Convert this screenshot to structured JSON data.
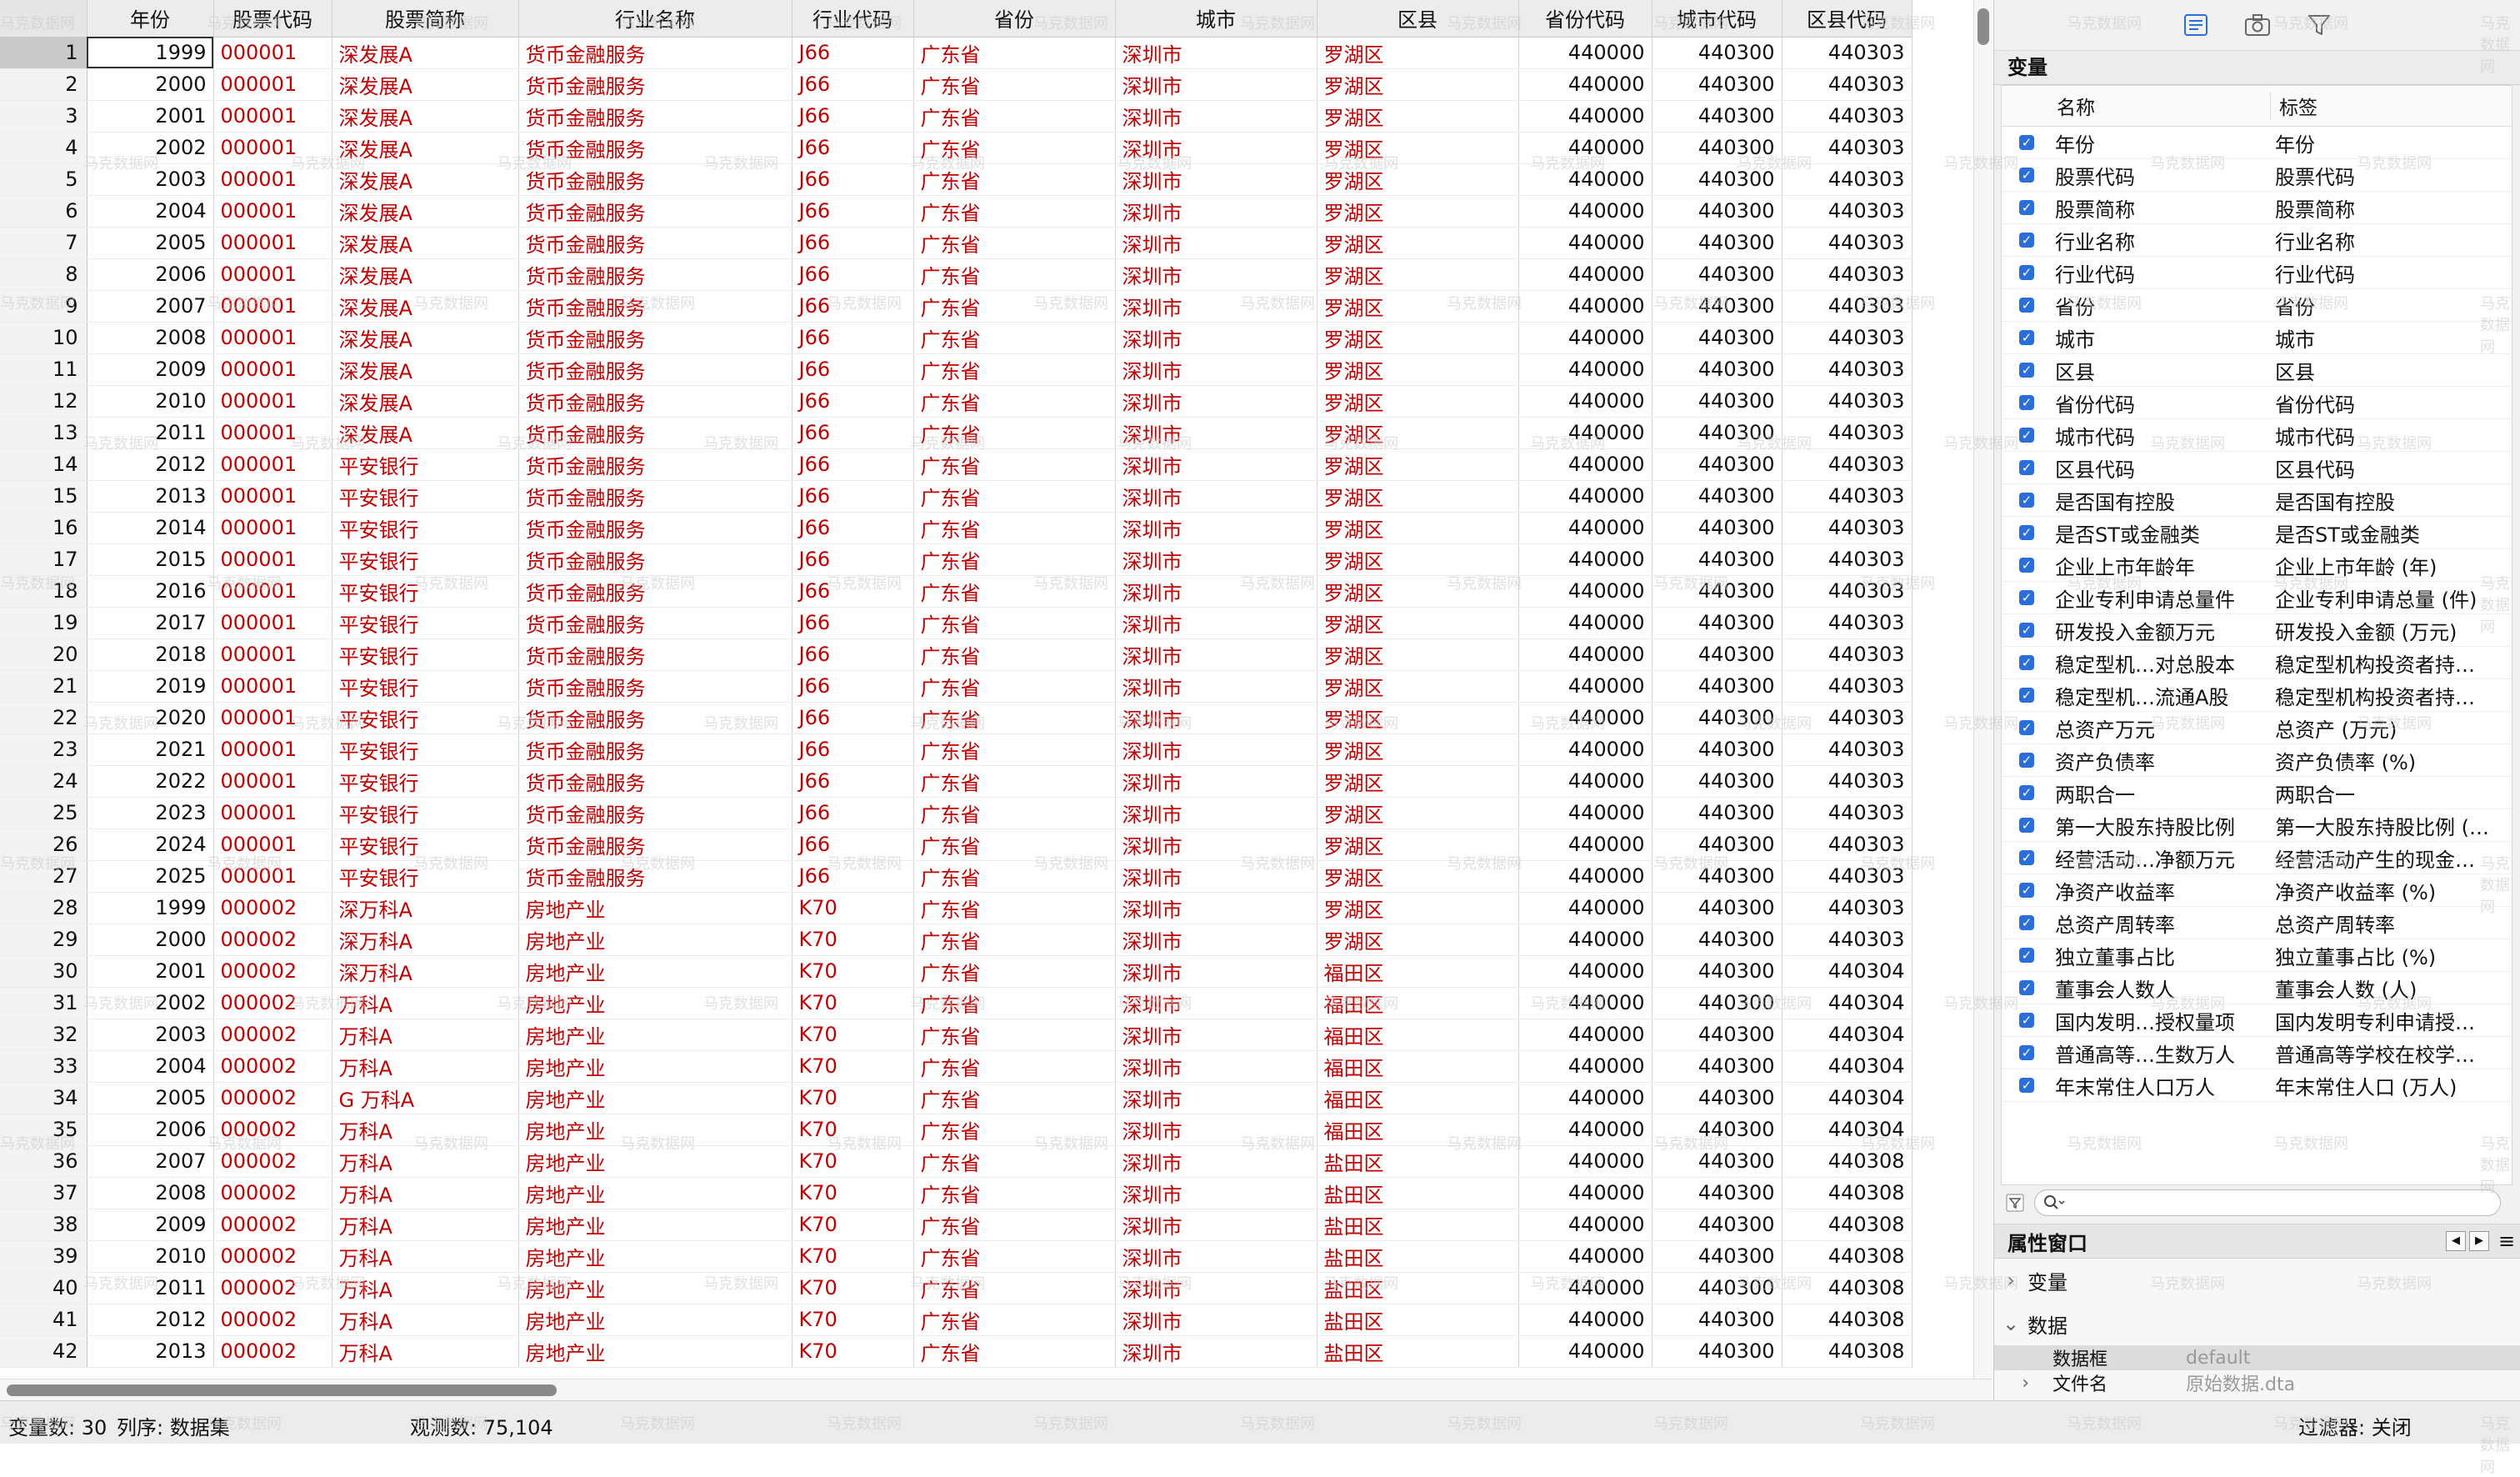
{
  "grid": {
    "columns": [
      {
        "key": "year",
        "label": "年份"
      },
      {
        "key": "code",
        "label": "股票代码"
      },
      {
        "key": "abbr",
        "label": "股票简称"
      },
      {
        "key": "industry",
        "label": "行业名称"
      },
      {
        "key": "ind_code",
        "label": "行业代码"
      },
      {
        "key": "province",
        "label": "省份"
      },
      {
        "key": "city",
        "label": "城市"
      },
      {
        "key": "district",
        "label": "区县"
      },
      {
        "key": "prov_code",
        "label": "省份代码"
      },
      {
        "key": "city_code",
        "label": "城市代码"
      },
      {
        "key": "dist_code",
        "label": "区县代码"
      }
    ],
    "rows": [
      [
        "1",
        "1999",
        "000001",
        "深发展A",
        "货币金融服务",
        "J66",
        "广东省",
        "深圳市",
        "罗湖区",
        "440000",
        "440300",
        "440303"
      ],
      [
        "2",
        "2000",
        "000001",
        "深发展A",
        "货币金融服务",
        "J66",
        "广东省",
        "深圳市",
        "罗湖区",
        "440000",
        "440300",
        "440303"
      ],
      [
        "3",
        "2001",
        "000001",
        "深发展A",
        "货币金融服务",
        "J66",
        "广东省",
        "深圳市",
        "罗湖区",
        "440000",
        "440300",
        "440303"
      ],
      [
        "4",
        "2002",
        "000001",
        "深发展A",
        "货币金融服务",
        "J66",
        "广东省",
        "深圳市",
        "罗湖区",
        "440000",
        "440300",
        "440303"
      ],
      [
        "5",
        "2003",
        "000001",
        "深发展A",
        "货币金融服务",
        "J66",
        "广东省",
        "深圳市",
        "罗湖区",
        "440000",
        "440300",
        "440303"
      ],
      [
        "6",
        "2004",
        "000001",
        "深发展A",
        "货币金融服务",
        "J66",
        "广东省",
        "深圳市",
        "罗湖区",
        "440000",
        "440300",
        "440303"
      ],
      [
        "7",
        "2005",
        "000001",
        "深发展A",
        "货币金融服务",
        "J66",
        "广东省",
        "深圳市",
        "罗湖区",
        "440000",
        "440300",
        "440303"
      ],
      [
        "8",
        "2006",
        "000001",
        "深发展A",
        "货币金融服务",
        "J66",
        "广东省",
        "深圳市",
        "罗湖区",
        "440000",
        "440300",
        "440303"
      ],
      [
        "9",
        "2007",
        "000001",
        "深发展A",
        "货币金融服务",
        "J66",
        "广东省",
        "深圳市",
        "罗湖区",
        "440000",
        "440300",
        "440303"
      ],
      [
        "10",
        "2008",
        "000001",
        "深发展A",
        "货币金融服务",
        "J66",
        "广东省",
        "深圳市",
        "罗湖区",
        "440000",
        "440300",
        "440303"
      ],
      [
        "11",
        "2009",
        "000001",
        "深发展A",
        "货币金融服务",
        "J66",
        "广东省",
        "深圳市",
        "罗湖区",
        "440000",
        "440300",
        "440303"
      ],
      [
        "12",
        "2010",
        "000001",
        "深发展A",
        "货币金融服务",
        "J66",
        "广东省",
        "深圳市",
        "罗湖区",
        "440000",
        "440300",
        "440303"
      ],
      [
        "13",
        "2011",
        "000001",
        "深发展A",
        "货币金融服务",
        "J66",
        "广东省",
        "深圳市",
        "罗湖区",
        "440000",
        "440300",
        "440303"
      ],
      [
        "14",
        "2012",
        "000001",
        "平安银行",
        "货币金融服务",
        "J66",
        "广东省",
        "深圳市",
        "罗湖区",
        "440000",
        "440300",
        "440303"
      ],
      [
        "15",
        "2013",
        "000001",
        "平安银行",
        "货币金融服务",
        "J66",
        "广东省",
        "深圳市",
        "罗湖区",
        "440000",
        "440300",
        "440303"
      ],
      [
        "16",
        "2014",
        "000001",
        "平安银行",
        "货币金融服务",
        "J66",
        "广东省",
        "深圳市",
        "罗湖区",
        "440000",
        "440300",
        "440303"
      ],
      [
        "17",
        "2015",
        "000001",
        "平安银行",
        "货币金融服务",
        "J66",
        "广东省",
        "深圳市",
        "罗湖区",
        "440000",
        "440300",
        "440303"
      ],
      [
        "18",
        "2016",
        "000001",
        "平安银行",
        "货币金融服务",
        "J66",
        "广东省",
        "深圳市",
        "罗湖区",
        "440000",
        "440300",
        "440303"
      ],
      [
        "19",
        "2017",
        "000001",
        "平安银行",
        "货币金融服务",
        "J66",
        "广东省",
        "深圳市",
        "罗湖区",
        "440000",
        "440300",
        "440303"
      ],
      [
        "20",
        "2018",
        "000001",
        "平安银行",
        "货币金融服务",
        "J66",
        "广东省",
        "深圳市",
        "罗湖区",
        "440000",
        "440300",
        "440303"
      ],
      [
        "21",
        "2019",
        "000001",
        "平安银行",
        "货币金融服务",
        "J66",
        "广东省",
        "深圳市",
        "罗湖区",
        "440000",
        "440300",
        "440303"
      ],
      [
        "22",
        "2020",
        "000001",
        "平安银行",
        "货币金融服务",
        "J66",
        "广东省",
        "深圳市",
        "罗湖区",
        "440000",
        "440300",
        "440303"
      ],
      [
        "23",
        "2021",
        "000001",
        "平安银行",
        "货币金融服务",
        "J66",
        "广东省",
        "深圳市",
        "罗湖区",
        "440000",
        "440300",
        "440303"
      ],
      [
        "24",
        "2022",
        "000001",
        "平安银行",
        "货币金融服务",
        "J66",
        "广东省",
        "深圳市",
        "罗湖区",
        "440000",
        "440300",
        "440303"
      ],
      [
        "25",
        "2023",
        "000001",
        "平安银行",
        "货币金融服务",
        "J66",
        "广东省",
        "深圳市",
        "罗湖区",
        "440000",
        "440300",
        "440303"
      ],
      [
        "26",
        "2024",
        "000001",
        "平安银行",
        "货币金融服务",
        "J66",
        "广东省",
        "深圳市",
        "罗湖区",
        "440000",
        "440300",
        "440303"
      ],
      [
        "27",
        "2025",
        "000001",
        "平安银行",
        "货币金融服务",
        "J66",
        "广东省",
        "深圳市",
        "罗湖区",
        "440000",
        "440300",
        "440303"
      ],
      [
        "28",
        "1999",
        "000002",
        "深万科A",
        "房地产业",
        "K70",
        "广东省",
        "深圳市",
        "罗湖区",
        "440000",
        "440300",
        "440303"
      ],
      [
        "29",
        "2000",
        "000002",
        "深万科A",
        "房地产业",
        "K70",
        "广东省",
        "深圳市",
        "罗湖区",
        "440000",
        "440300",
        "440303"
      ],
      [
        "30",
        "2001",
        "000002",
        "深万科A",
        "房地产业",
        "K70",
        "广东省",
        "深圳市",
        "福田区",
        "440000",
        "440300",
        "440304"
      ],
      [
        "31",
        "2002",
        "000002",
        "万科A",
        "房地产业",
        "K70",
        "广东省",
        "深圳市",
        "福田区",
        "440000",
        "440300",
        "440304"
      ],
      [
        "32",
        "2003",
        "000002",
        "万科A",
        "房地产业",
        "K70",
        "广东省",
        "深圳市",
        "福田区",
        "440000",
        "440300",
        "440304"
      ],
      [
        "33",
        "2004",
        "000002",
        "万科A",
        "房地产业",
        "K70",
        "广东省",
        "深圳市",
        "福田区",
        "440000",
        "440300",
        "440304"
      ],
      [
        "34",
        "2005",
        "000002",
        "G 万科A",
        "房地产业",
        "K70",
        "广东省",
        "深圳市",
        "福田区",
        "440000",
        "440300",
        "440304"
      ],
      [
        "35",
        "2006",
        "000002",
        "万科A",
        "房地产业",
        "K70",
        "广东省",
        "深圳市",
        "福田区",
        "440000",
        "440300",
        "440304"
      ],
      [
        "36",
        "2007",
        "000002",
        "万科A",
        "房地产业",
        "K70",
        "广东省",
        "深圳市",
        "盐田区",
        "440000",
        "440300",
        "440308"
      ],
      [
        "37",
        "2008",
        "000002",
        "万科A",
        "房地产业",
        "K70",
        "广东省",
        "深圳市",
        "盐田区",
        "440000",
        "440300",
        "440308"
      ],
      [
        "38",
        "2009",
        "000002",
        "万科A",
        "房地产业",
        "K70",
        "广东省",
        "深圳市",
        "盐田区",
        "440000",
        "440300",
        "440308"
      ],
      [
        "39",
        "2010",
        "000002",
        "万科A",
        "房地产业",
        "K70",
        "广东省",
        "深圳市",
        "盐田区",
        "440000",
        "440300",
        "440308"
      ],
      [
        "40",
        "2011",
        "000002",
        "万科A",
        "房地产业",
        "K70",
        "广东省",
        "深圳市",
        "盐田区",
        "440000",
        "440300",
        "440308"
      ],
      [
        "41",
        "2012",
        "000002",
        "万科A",
        "房地产业",
        "K70",
        "广东省",
        "深圳市",
        "盐田区",
        "440000",
        "440300",
        "440308"
      ],
      [
        "42",
        "2013",
        "000002",
        "万科A",
        "房地产业",
        "K70",
        "广东省",
        "深圳市",
        "盐田区",
        "440000",
        "440300",
        "440308"
      ]
    ]
  },
  "panel": {
    "toolbar_icons": [
      "variables-list-icon",
      "camera-snapshot-icon",
      "filter-icon"
    ],
    "variables_title": "变量",
    "var_headers": {
      "name": "名称",
      "label": "标签"
    },
    "variables": [
      {
        "name": "年份",
        "label": "年份"
      },
      {
        "name": "股票代码",
        "label": "股票代码"
      },
      {
        "name": "股票简称",
        "label": "股票简称"
      },
      {
        "name": "行业名称",
        "label": "行业名称"
      },
      {
        "name": "行业代码",
        "label": "行业代码"
      },
      {
        "name": "省份",
        "label": "省份"
      },
      {
        "name": "城市",
        "label": "城市"
      },
      {
        "name": "区县",
        "label": "区县"
      },
      {
        "name": "省份代码",
        "label": "省份代码"
      },
      {
        "name": "城市代码",
        "label": "城市代码"
      },
      {
        "name": "区县代码",
        "label": "区县代码"
      },
      {
        "name": "是否国有控股",
        "label": "是否国有控股"
      },
      {
        "name": "是否ST或金融类",
        "label": "是否ST或金融类"
      },
      {
        "name": "企业上市年龄年",
        "label": "企业上市年龄 (年)"
      },
      {
        "name": "企业专利申请总量件",
        "label": "企业专利申请总量 (件)"
      },
      {
        "name": "研发投入金额万元",
        "label": "研发投入金额 (万元)"
      },
      {
        "name": "稳定型机…对总股本",
        "label": "稳定型机构投资者持…"
      },
      {
        "name": "稳定型机…流通A股",
        "label": "稳定型机构投资者持…"
      },
      {
        "name": "总资产万元",
        "label": "总资产 (万元)"
      },
      {
        "name": "资产负债率",
        "label": "资产负债率 (%)"
      },
      {
        "name": "两职合一",
        "label": "两职合一"
      },
      {
        "name": "第一大股东持股比例",
        "label": "第一大股东持股比例 (…"
      },
      {
        "name": "经营活动…净额万元",
        "label": "经营活动产生的现金…"
      },
      {
        "name": "净资产收益率",
        "label": "净资产收益率 (%)"
      },
      {
        "name": "总资产周转率",
        "label": "总资产周转率"
      },
      {
        "name": "独立董事占比",
        "label": "独立董事占比 (%)"
      },
      {
        "name": "董事会人数人",
        "label": "董事会人数 (人)"
      },
      {
        "name": "国内发明…授权量项",
        "label": "国内发明专利申请授…"
      },
      {
        "name": "普通高等…生数万人",
        "label": "普通高等学校在校学…"
      },
      {
        "name": "年末常住人口万人",
        "label": "年末常住人口 (万人)"
      }
    ],
    "search_placeholder": "",
    "properties_title": "属性窗口",
    "prop_sections": {
      "variables": "变量",
      "data": "数据"
    },
    "prop_rows": [
      {
        "key": "数据框",
        "value": "default"
      },
      {
        "key": "文件名",
        "value": "原始数据.dta"
      }
    ]
  },
  "status": {
    "var_count": "变量数:  30",
    "sort": "列序:  数据集",
    "obs": "观测数:  75,104",
    "filter": "过滤器:  关闭"
  },
  "watermark": "马克数据网",
  "colors": {
    "string_text": "#c00000",
    "accent": "#2a6edb"
  }
}
